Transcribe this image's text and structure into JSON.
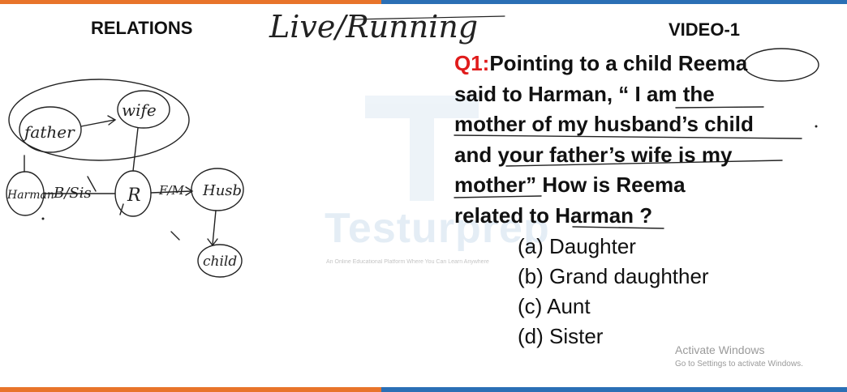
{
  "header": {
    "title": "RELATIONS",
    "handwritten_note": "Live/Running",
    "video_label": "VIDEO-1"
  },
  "question": {
    "number": "Q1:",
    "lines": [
      "Pointing to a child Reema",
      "said to Harman, “ I am the",
      "mother of my husband’s child",
      "and your father’s wife is my",
      "mother” How is  Reema",
      "related to Harman ?"
    ]
  },
  "options": [
    "(a) Daughter",
    "(b) Grand daughther",
    "(c) Aunt",
    "(d) Sister"
  ],
  "diagram": {
    "nodes": [
      "father",
      "wife",
      "Harman",
      "R",
      "Husb",
      "child"
    ],
    "edge_labels": [
      "B/Sis",
      "F/M"
    ]
  },
  "watermark": {
    "brand": "Testurprep",
    "tagline": "An Online Educational Platform Where You Can Learn Anywhere"
  },
  "system": {
    "activate_title": "Activate Windows",
    "activate_sub": "Go to Settings to activate Windows."
  },
  "colors": {
    "accent_red": "#e01b1b",
    "bar_orange": "#e8742a",
    "bar_blue": "#2b6fb5"
  }
}
